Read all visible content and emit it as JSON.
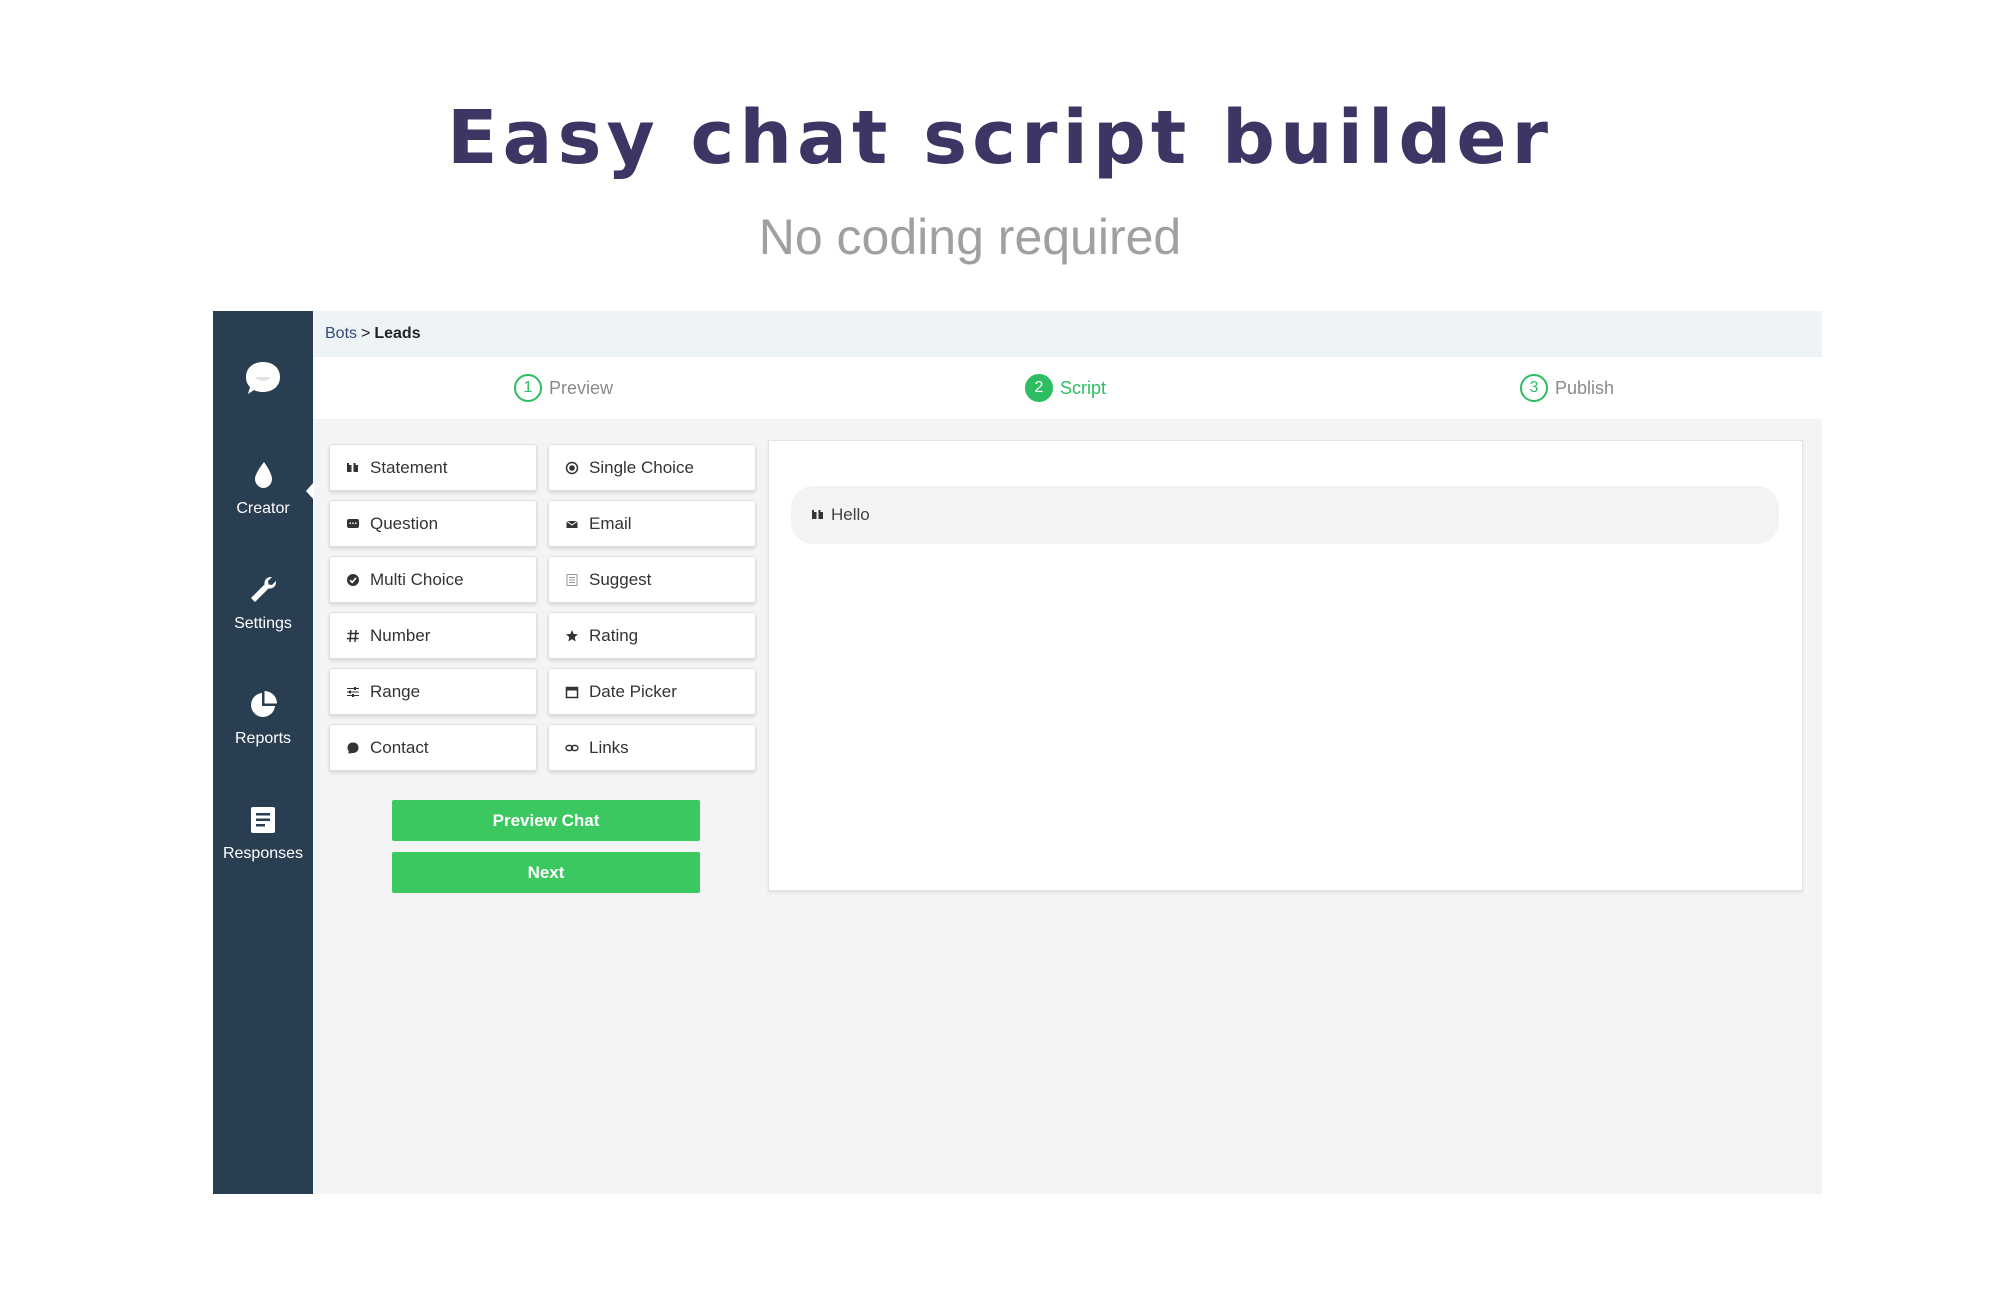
{
  "hero": {
    "title": "Easy chat script builder",
    "subtitle": "No coding required"
  },
  "sidebar": {
    "logo_icon": "chat-bubble-icon",
    "items": [
      {
        "label": "Creator",
        "icon": "drop-icon",
        "active": true
      },
      {
        "label": "Settings",
        "icon": "wrench-icon"
      },
      {
        "label": "Reports",
        "icon": "pie-chart-icon"
      },
      {
        "label": "Responses",
        "icon": "document-icon"
      }
    ]
  },
  "breadcrumb": {
    "link": "Bots",
    "separator": ">",
    "current": "Leads"
  },
  "steps": [
    {
      "number": "1",
      "label": "Preview",
      "active": false
    },
    {
      "number": "2",
      "label": "Script",
      "active": true
    },
    {
      "number": "3",
      "label": "Publish",
      "active": false
    }
  ],
  "blocks": [
    {
      "label": "Statement",
      "icon": "quote-icon"
    },
    {
      "label": "Single Choice",
      "icon": "radio-icon"
    },
    {
      "label": "Question",
      "icon": "speech-box-icon"
    },
    {
      "label": "Email",
      "icon": "envelope-icon"
    },
    {
      "label": "Multi Choice",
      "icon": "check-circle-icon"
    },
    {
      "label": "Suggest",
      "icon": "list-icon"
    },
    {
      "label": "Number",
      "icon": "hash-icon"
    },
    {
      "label": "Rating",
      "icon": "star-icon"
    },
    {
      "label": "Range",
      "icon": "sliders-icon"
    },
    {
      "label": "Date Picker",
      "icon": "calendar-icon"
    },
    {
      "label": "Contact",
      "icon": "bubble-icon"
    },
    {
      "label": "Links",
      "icon": "link-icon"
    }
  ],
  "buttons": {
    "preview_chat": "Preview Chat",
    "next": "Next"
  },
  "script": {
    "items": [
      {
        "label": "Hello",
        "icon": "quote-icon"
      }
    ]
  },
  "colors": {
    "sidebar": "#2a3e52",
    "accent_green": "#3cc860",
    "step_green": "#2ebd62",
    "title": "#3d3564",
    "subtitle": "#a0a0a0"
  }
}
